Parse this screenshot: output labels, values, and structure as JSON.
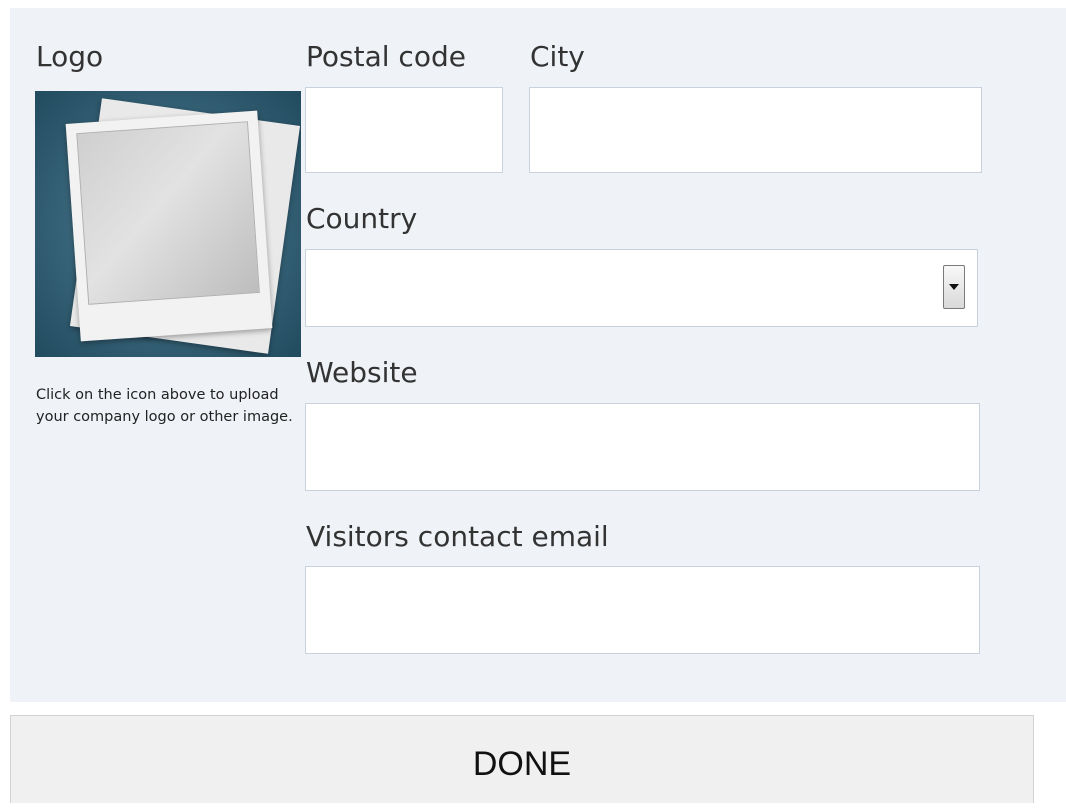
{
  "logo": {
    "label": "Logo",
    "hint": "Click on the icon above to upload your company logo or other image."
  },
  "form": {
    "postal_code": {
      "label": "Postal code",
      "value": ""
    },
    "city": {
      "label": "City",
      "value": ""
    },
    "country": {
      "label": "Country",
      "value": ""
    },
    "website": {
      "label": "Website",
      "value": ""
    },
    "contact_email": {
      "label": "Visitors contact email",
      "value": ""
    }
  },
  "actions": {
    "done_label": "DONE"
  },
  "colors": {
    "panel_bg": "#eff2f7",
    "field_border": "#c9d1dd",
    "logo_bg": "#2e5a6e"
  }
}
